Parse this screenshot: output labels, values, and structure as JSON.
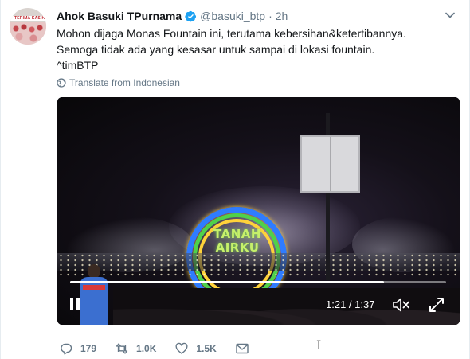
{
  "tweet": {
    "author_name": "Ahok Basuki TPurnama",
    "handle": "@basuki_btp",
    "separator": "·",
    "time": "2h",
    "lines": [
      "Mohon dijaga Monas Fountain ini, terutama kebersihan&ketertibannya.",
      "Semoga tidak ada yang kesasar untuk sampai di lokasi fountain.",
      "^timBTP"
    ],
    "translate_label": "Translate from Indonesian"
  },
  "avatar": {
    "banner_text": "TERIMA KASIH"
  },
  "video": {
    "projection_text": [
      "TANAH",
      "AIRKU"
    ],
    "timecode": "1:21 / 1:37",
    "progress": 0.835
  },
  "actions": {
    "replies": "179",
    "retweets": "1.0K",
    "likes": "1.5K"
  },
  "colors": {
    "verified": "#1da1f2",
    "muted_text": "#657786",
    "text": "#14171a"
  },
  "icons": [
    "verified-icon",
    "caret-down-icon",
    "globe-icon",
    "pause-icon",
    "mute-icon",
    "fullscreen-icon",
    "reply-icon",
    "retweet-icon",
    "like-icon",
    "message-icon"
  ]
}
